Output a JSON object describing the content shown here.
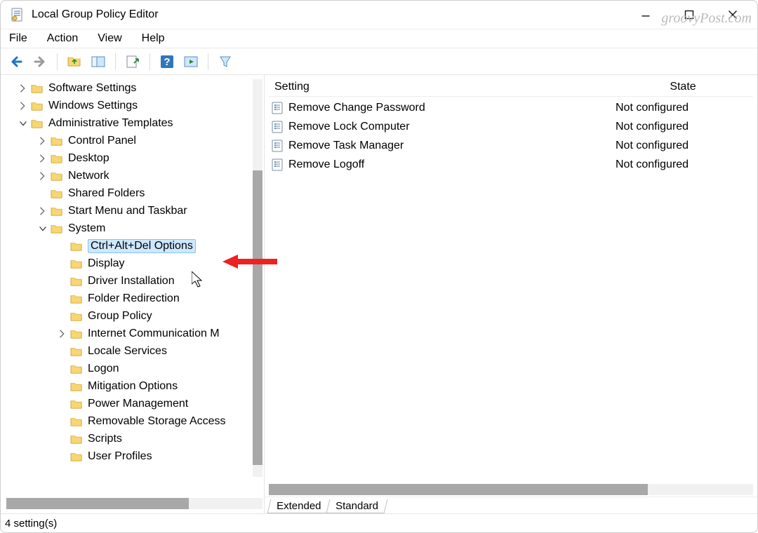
{
  "title": "Local Group Policy Editor",
  "watermark": "groovyPost.com",
  "menu": {
    "file": "File",
    "action": "Action",
    "view": "View",
    "help": "Help"
  },
  "tree": {
    "n0": "Software Settings",
    "n1": "Windows Settings",
    "n2": "Administrative Templates",
    "n3": "Control Panel",
    "n4": "Desktop",
    "n5": "Network",
    "n6": "Shared Folders",
    "n7": "Start Menu and Taskbar",
    "n8": "System",
    "n9": "Ctrl+Alt+Del Options",
    "n10": "Display",
    "n11": "Driver Installation",
    "n12": "Folder Redirection",
    "n13": "Group Policy",
    "n14": "Internet Communication M",
    "n15": "Locale Services",
    "n16": "Logon",
    "n17": "Mitigation Options",
    "n18": "Power Management",
    "n19": "Removable Storage Access",
    "n20": "Scripts",
    "n21": "User Profiles"
  },
  "list": {
    "header_setting": "Setting",
    "header_state": "State",
    "rows": [
      {
        "setting": "Remove Change Password",
        "state": "Not configured"
      },
      {
        "setting": "Remove Lock Computer",
        "state": "Not configured"
      },
      {
        "setting": "Remove Task Manager",
        "state": "Not configured"
      },
      {
        "setting": "Remove Logoff",
        "state": "Not configured"
      }
    ]
  },
  "tabs": {
    "extended": "Extended",
    "standard": "Standard"
  },
  "status": "4 setting(s)"
}
